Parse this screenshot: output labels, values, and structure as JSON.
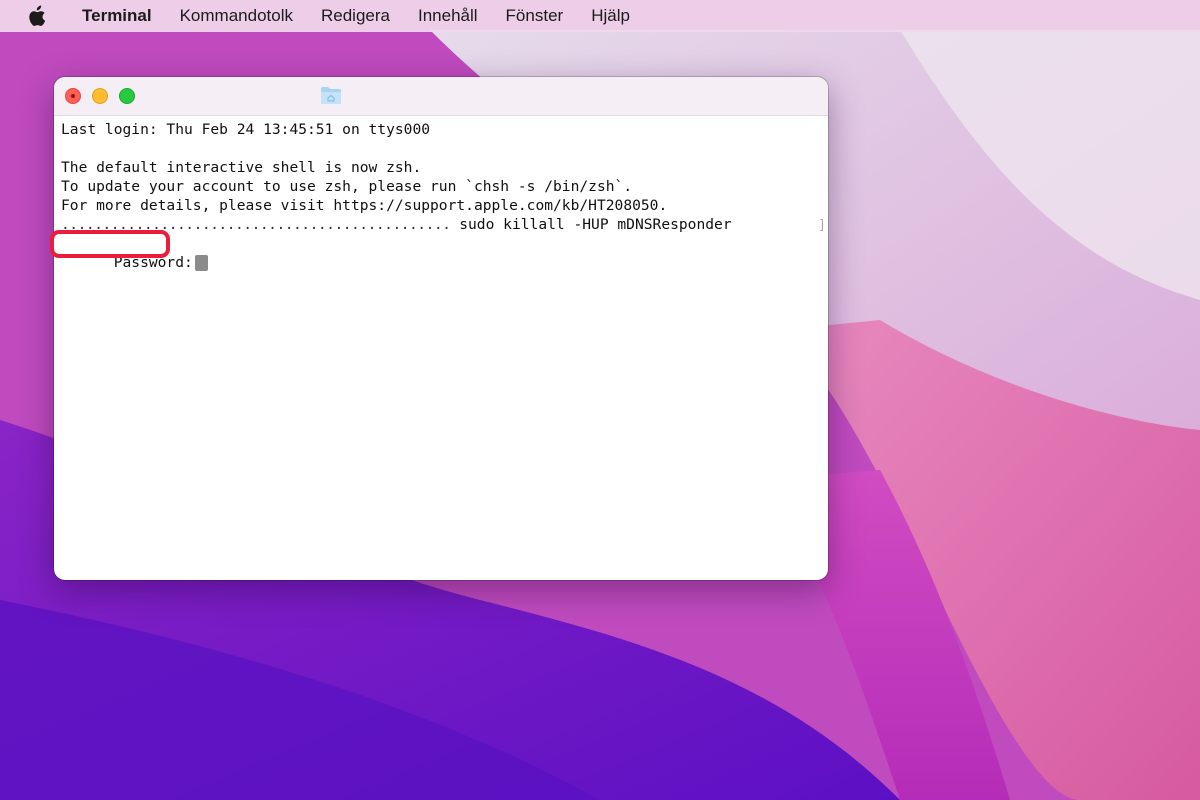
{
  "menubar": {
    "apple_icon": "apple-logo-icon",
    "app_name": "Terminal",
    "items": [
      "Kommandotolk",
      "Redigera",
      "Innehåll",
      "Fönster",
      "Hjälp"
    ]
  },
  "window": {
    "title_icon": "home-folder-icon",
    "lines": [
      "Last login: Thu Feb 24 13:45:51 on ttys000",
      "",
      "The default interactive shell is now zsh.",
      "To update your account to use zsh, please run `chsh -s /bin/zsh`.",
      "For more details, please visit https://support.apple.com/kb/HT208050."
    ],
    "command_prefix": "...............................................",
    "command": " sudo killall -HUP mDNSResponder",
    "password_prompt": "Password:",
    "cursor_icon": "key-icon"
  },
  "colors": {
    "highlight": "#ec1c3c",
    "close": "#ff5f57",
    "minimize": "#febc2e",
    "zoom": "#28c840"
  }
}
